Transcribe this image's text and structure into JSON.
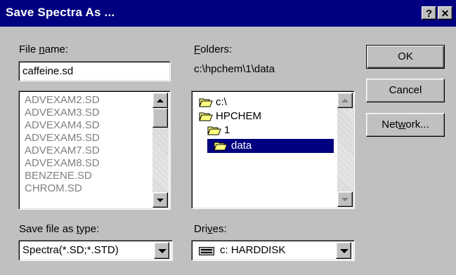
{
  "window": {
    "title": "Save Spectra As ...",
    "help_btn": "?",
    "close_btn": "✕"
  },
  "filename": {
    "label_pre": "File ",
    "label_accel": "n",
    "label_post": "ame:",
    "value": "caffeine.sd"
  },
  "files": {
    "items": [
      "ADVEXAM2.SD",
      "ADVEXAM3.SD",
      "ADVEXAM4.SD",
      "ADVEXAM5.SD",
      "ADVEXAM7.SD",
      "ADVEXAM8.SD",
      "BENZENE.SD",
      "CHROM.SD"
    ]
  },
  "folders": {
    "label_accel": "F",
    "label_post": "olders:",
    "path": "c:\\hpchem\\1\\data",
    "items": [
      {
        "label": "c:\\",
        "state": "open"
      },
      {
        "label": "HPCHEM",
        "state": "open"
      },
      {
        "label": "1",
        "state": "open"
      },
      {
        "label": "data",
        "state": "open-selected"
      }
    ]
  },
  "buttons": {
    "ok": "OK",
    "cancel": "Cancel",
    "network_pre": "Net",
    "network_accel": "w",
    "network_post": "ork..."
  },
  "save_type": {
    "label_pre": "Save file as ",
    "label_accel": "t",
    "label_post": "ype:",
    "value": "Spectra(*.SD;*.STD)"
  },
  "drives": {
    "label_pre": "Dri",
    "label_accel": "v",
    "label_post": "es:",
    "value": "c: HARDDISK"
  },
  "colors": {
    "title_bg": "#000080",
    "face": "#c0c0c0",
    "selection": "#000080",
    "disabled_text": "#808080"
  }
}
